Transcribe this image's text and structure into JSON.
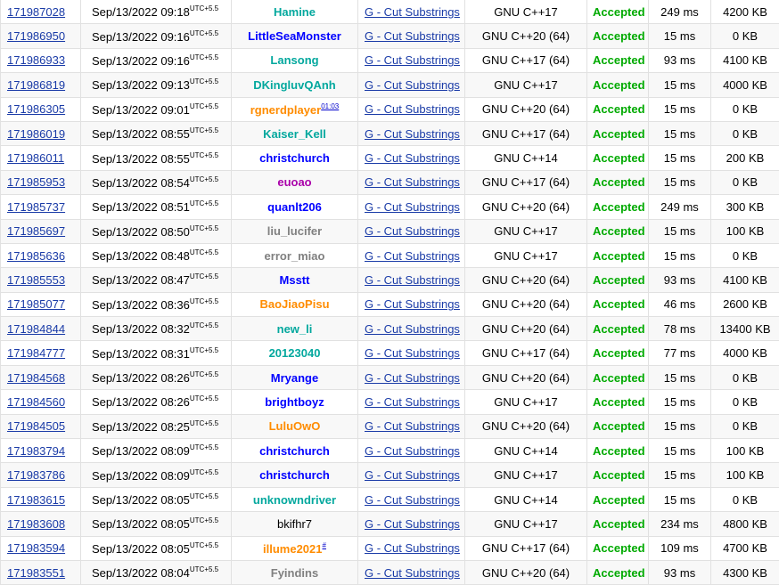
{
  "colors": {
    "link": "#1a3ba7",
    "accepted": "#00aa00",
    "expert": "#0000ff",
    "specialist": "#03a89e",
    "pupil": "#008000",
    "candidate_master": "#aa00aa",
    "master": "#ff8c00",
    "newbie": "#808080",
    "unrated": "#000000",
    "row_alt": "#f8f8f8",
    "border": "#e1e1e1"
  },
  "utc_label": "UTC+5.5",
  "submissions": [
    {
      "id": "171987028",
      "time": "Sep/13/2022 09:18",
      "party": "Hamine",
      "party_color": "#03a89e",
      "problem": "G - Cut Substrings",
      "lang": "GNU C++17",
      "verdict": "Accepted",
      "time_used": "249 ms",
      "memory": "4200 KB"
    },
    {
      "id": "171986950",
      "time": "Sep/13/2022 09:16",
      "party": "LittleSeaMonster",
      "party_color": "#0000ff",
      "problem": "G - Cut Substrings",
      "lang": "GNU C++20 (64)",
      "verdict": "Accepted",
      "time_used": "15 ms",
      "memory": "0 KB"
    },
    {
      "id": "171986933",
      "time": "Sep/13/2022 09:16",
      "party": "Lansong",
      "party_color": "#03a89e",
      "problem": "G - Cut Substrings",
      "lang": "GNU C++17 (64)",
      "verdict": "Accepted",
      "time_used": "93 ms",
      "memory": "4100 KB"
    },
    {
      "id": "171986819",
      "time": "Sep/13/2022 09:13",
      "party": "DKingluvQAnh",
      "party_color": "#03a89e",
      "problem": "G - Cut Substrings",
      "lang": "GNU C++17",
      "verdict": "Accepted",
      "time_used": "15 ms",
      "memory": "4000 KB"
    },
    {
      "id": "171986305",
      "time": "Sep/13/2022 09:01",
      "party": "rgnerdplayer",
      "party_color": "#ff8c00",
      "party_sup": "01:03",
      "problem": "G - Cut Substrings",
      "lang": "GNU C++20 (64)",
      "verdict": "Accepted",
      "time_used": "15 ms",
      "memory": "0 KB"
    },
    {
      "id": "171986019",
      "time": "Sep/13/2022 08:55",
      "party": "Kaiser_Kell",
      "party_color": "#03a89e",
      "problem": "G - Cut Substrings",
      "lang": "GNU C++17 (64)",
      "verdict": "Accepted",
      "time_used": "15 ms",
      "memory": "0 KB"
    },
    {
      "id": "171986011",
      "time": "Sep/13/2022 08:55",
      "party": "christchurch",
      "party_color": "#0000ff",
      "problem": "G - Cut Substrings",
      "lang": "GNU C++14",
      "verdict": "Accepted",
      "time_used": "15 ms",
      "memory": "200 KB"
    },
    {
      "id": "171985953",
      "time": "Sep/13/2022 08:54",
      "party": "euoao",
      "party_color": "#aa00aa",
      "problem": "G - Cut Substrings",
      "lang": "GNU C++17 (64)",
      "verdict": "Accepted",
      "time_used": "15 ms",
      "memory": "0 KB"
    },
    {
      "id": "171985737",
      "time": "Sep/13/2022 08:51",
      "party": "quanlt206",
      "party_color": "#0000ff",
      "problem": "G - Cut Substrings",
      "lang": "GNU C++20 (64)",
      "verdict": "Accepted",
      "time_used": "249 ms",
      "memory": "300 KB"
    },
    {
      "id": "171985697",
      "time": "Sep/13/2022 08:50",
      "party": "liu_lucifer",
      "party_color": "#808080",
      "problem": "G - Cut Substrings",
      "lang": "GNU C++17",
      "verdict": "Accepted",
      "time_used": "15 ms",
      "memory": "100 KB"
    },
    {
      "id": "171985636",
      "time": "Sep/13/2022 08:48",
      "party": "error_miao",
      "party_color": "#808080",
      "problem": "G - Cut Substrings",
      "lang": "GNU C++17",
      "verdict": "Accepted",
      "time_used": "15 ms",
      "memory": "0 KB"
    },
    {
      "id": "171985553",
      "time": "Sep/13/2022 08:47",
      "party": "Msstt",
      "party_color": "#0000ff",
      "problem": "G - Cut Substrings",
      "lang": "GNU C++20 (64)",
      "verdict": "Accepted",
      "time_used": "93 ms",
      "memory": "4100 KB"
    },
    {
      "id": "171985077",
      "time": "Sep/13/2022 08:36",
      "party": "BaoJiaoPisu",
      "party_color": "#ff8c00",
      "problem": "G - Cut Substrings",
      "lang": "GNU C++20 (64)",
      "verdict": "Accepted",
      "time_used": "46 ms",
      "memory": "2600 KB"
    },
    {
      "id": "171984844",
      "time": "Sep/13/2022 08:32",
      "party": "new_li",
      "party_color": "#03a89e",
      "problem": "G - Cut Substrings",
      "lang": "GNU C++20 (64)",
      "verdict": "Accepted",
      "time_used": "78 ms",
      "memory": "13400 KB"
    },
    {
      "id": "171984777",
      "time": "Sep/13/2022 08:31",
      "party": "20123040",
      "party_color": "#03a89e",
      "problem": "G - Cut Substrings",
      "lang": "GNU C++17 (64)",
      "verdict": "Accepted",
      "time_used": "77 ms",
      "memory": "4000 KB"
    },
    {
      "id": "171984568",
      "time": "Sep/13/2022 08:26",
      "party": "Mryange",
      "party_color": "#0000ff",
      "problem": "G - Cut Substrings",
      "lang": "GNU C++20 (64)",
      "verdict": "Accepted",
      "time_used": "15 ms",
      "memory": "0 KB"
    },
    {
      "id": "171984560",
      "time": "Sep/13/2022 08:26",
      "party": "brightboyz",
      "party_color": "#0000ff",
      "problem": "G - Cut Substrings",
      "lang": "GNU C++17",
      "verdict": "Accepted",
      "time_used": "15 ms",
      "memory": "0 KB"
    },
    {
      "id": "171984505",
      "time": "Sep/13/2022 08:25",
      "party": "LuluOwO",
      "party_color": "#ff8c00",
      "problem": "G - Cut Substrings",
      "lang": "GNU C++20 (64)",
      "verdict": "Accepted",
      "time_used": "15 ms",
      "memory": "0 KB"
    },
    {
      "id": "171983794",
      "time": "Sep/13/2022 08:09",
      "party": "christchurch",
      "party_color": "#0000ff",
      "problem": "G - Cut Substrings",
      "lang": "GNU C++14",
      "verdict": "Accepted",
      "time_used": "15 ms",
      "memory": "100 KB"
    },
    {
      "id": "171983786",
      "time": "Sep/13/2022 08:09",
      "party": "christchurch",
      "party_color": "#0000ff",
      "problem": "G - Cut Substrings",
      "lang": "GNU C++17",
      "verdict": "Accepted",
      "time_used": "15 ms",
      "memory": "100 KB"
    },
    {
      "id": "171983615",
      "time": "Sep/13/2022 08:05",
      "party": "unknowndriver",
      "party_color": "#03a89e",
      "problem": "G - Cut Substrings",
      "lang": "GNU C++14",
      "verdict": "Accepted",
      "time_used": "15 ms",
      "memory": "0 KB"
    },
    {
      "id": "171983608",
      "time": "Sep/13/2022 08:05",
      "party": "bkifhr7",
      "party_color": "#000000",
      "party_bold": false,
      "problem": "G - Cut Substrings",
      "lang": "GNU C++17",
      "verdict": "Accepted",
      "time_used": "234 ms",
      "memory": "4800 KB"
    },
    {
      "id": "171983594",
      "time": "Sep/13/2022 08:05",
      "party": "illume2021",
      "party_color": "#ff8c00",
      "party_sup": "#",
      "problem": "G - Cut Substrings",
      "lang": "GNU C++17 (64)",
      "verdict": "Accepted",
      "time_used": "109 ms",
      "memory": "4700 KB"
    },
    {
      "id": "171983551",
      "time": "Sep/13/2022 08:04",
      "party": "Fyindins",
      "party_color": "#808080",
      "problem": "G - Cut Substrings",
      "lang": "GNU C++20 (64)",
      "verdict": "Accepted",
      "time_used": "93 ms",
      "memory": "4300 KB"
    }
  ]
}
